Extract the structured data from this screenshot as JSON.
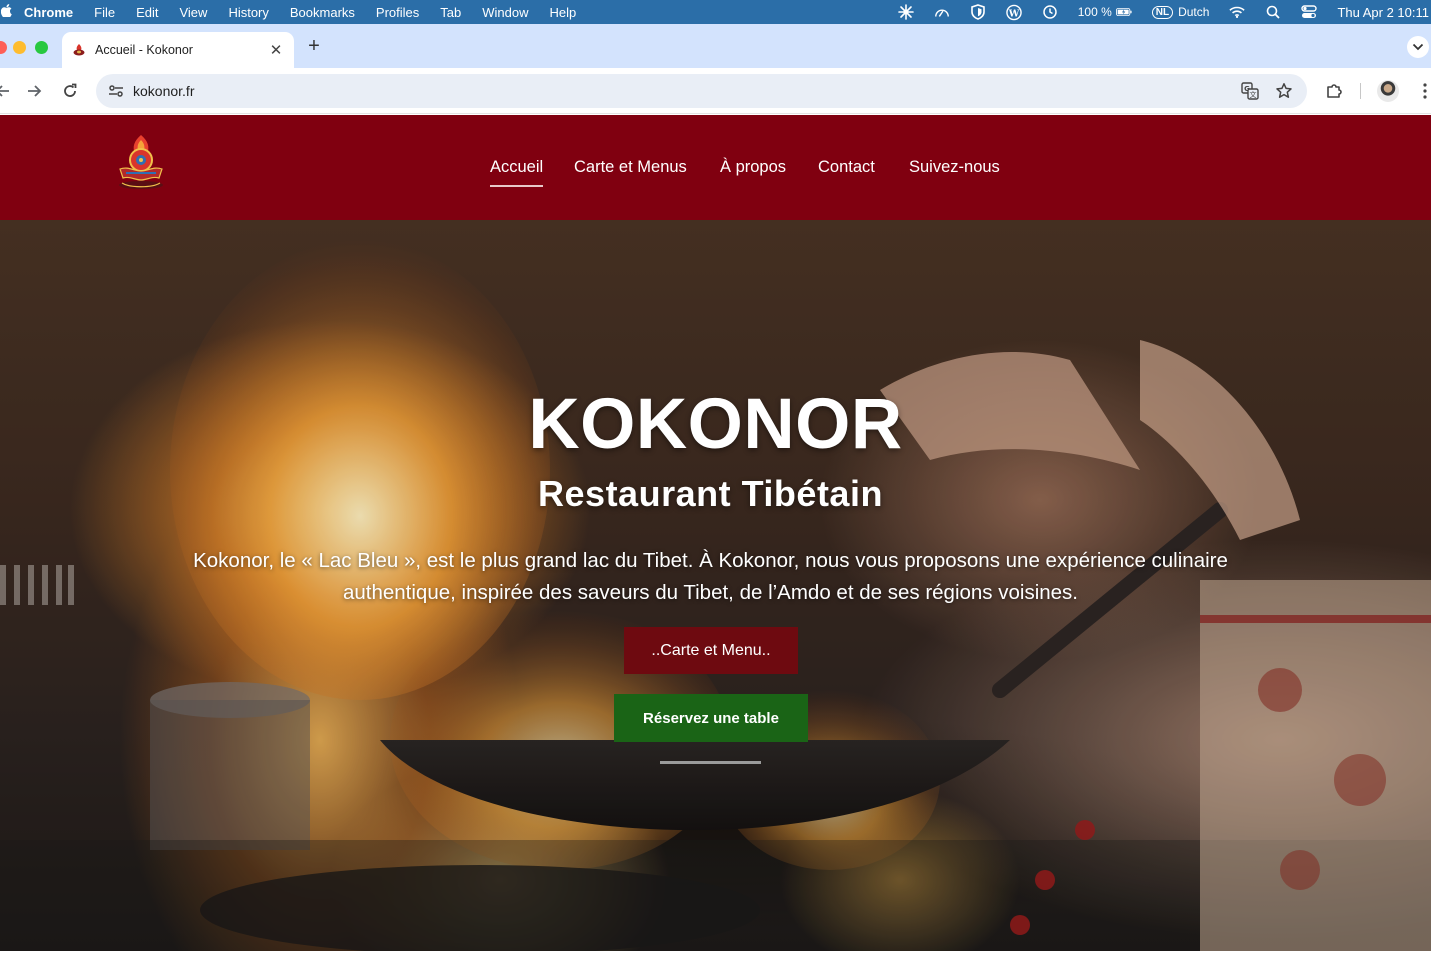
{
  "os_menubar": {
    "app": "Chrome",
    "items": [
      "File",
      "Edit",
      "View",
      "History",
      "Bookmarks",
      "Profiles",
      "Tab",
      "Window",
      "Help"
    ],
    "battery": "100 %",
    "input_badge": "NL",
    "input_language": "Dutch",
    "clock": "Thu Apr 2  10:11"
  },
  "browser": {
    "tab_title": "Accueil - Kokonor",
    "url": "kokonor.fr"
  },
  "site": {
    "nav": [
      "Accueil",
      "Carte et Menus",
      "À propos",
      "Contact",
      "Suivez-nous"
    ],
    "active_nav": "Accueil",
    "colors": {
      "header_bg": "#800010",
      "menu_button_bg": "#6e0a10",
      "reserve_button_bg": "#1a6416"
    }
  },
  "hero": {
    "title": "KOKONOR",
    "subtitle": "Restaurant Tibétain",
    "description": "Kokonor, le « Lac Bleu », est le plus grand lac du Tibet. À Kokonor, nous vous proposons une expérience culinaire authentique, inspirée des saveurs du Tibet, de l’Amdo et de ses régions voisines.",
    "menu_button": "..Carte et Menu..",
    "reserve_button": "Réservez une table"
  }
}
